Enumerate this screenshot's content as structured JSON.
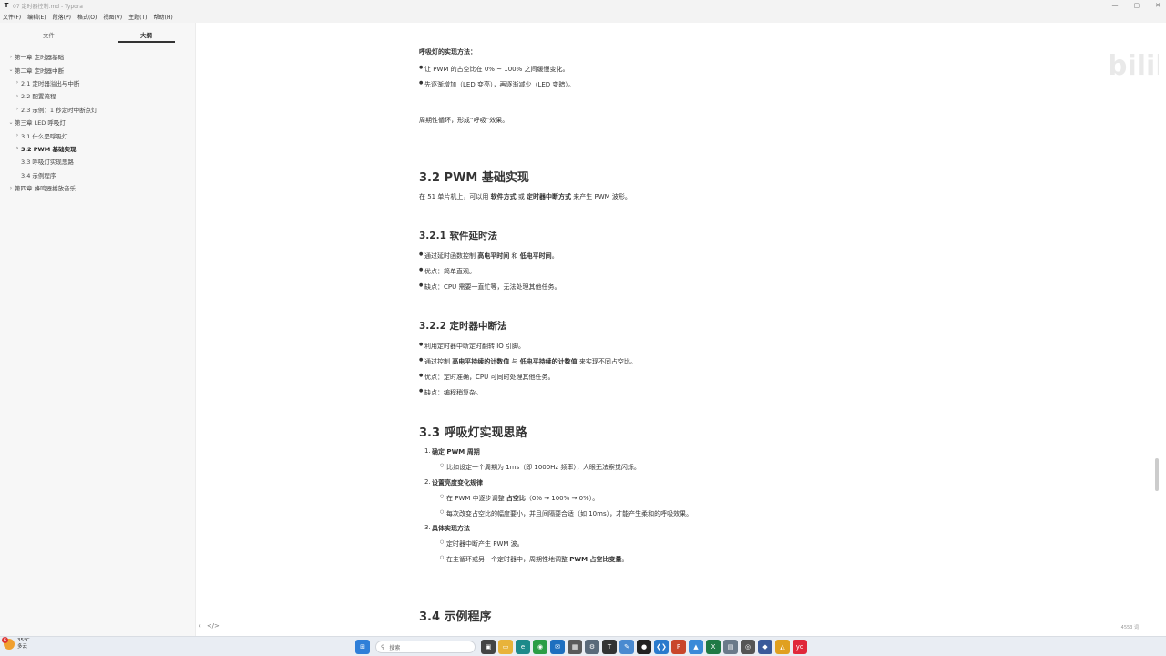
{
  "window": {
    "title": "07 定时器控制.md - Typora",
    "app_icon": "T",
    "minimize": "—",
    "maximize": "▢",
    "close": "✕"
  },
  "menu": [
    "文件(F)",
    "编辑(E)",
    "段落(P)",
    "格式(O)",
    "视图(V)",
    "主题(T)",
    "帮助(H)"
  ],
  "sidebar": {
    "tabs": [
      "文件",
      "大纲"
    ],
    "active_tab": 1,
    "outline": [
      {
        "label": "第一章 定时器基础",
        "level": 1,
        "chevron": "›",
        "active": false
      },
      {
        "label": "第二章 定时器中断",
        "level": 1,
        "chevron": "⌄",
        "active": false
      },
      {
        "label": "2.1 定时器溢出与中断",
        "level": 2,
        "chevron": "›",
        "active": false
      },
      {
        "label": "2.2 配置流程",
        "level": 2,
        "chevron": "›",
        "active": false
      },
      {
        "label": "2.3 示例：1 秒定时中断点灯",
        "level": 2,
        "chevron": "›",
        "active": false
      },
      {
        "label": "第三章 LED 呼吸灯",
        "level": 1,
        "chevron": "⌄",
        "active": false
      },
      {
        "label": "3.1 什么是呼吸灯",
        "level": 2,
        "chevron": "›",
        "active": false
      },
      {
        "label": "3.2 PWM 基础实现",
        "level": 2,
        "chevron": "›",
        "active": true
      },
      {
        "label": "3.3 呼吸灯实现思路",
        "level": 2,
        "chevron": "",
        "active": false
      },
      {
        "label": "3.4 示例程序",
        "level": 2,
        "chevron": "",
        "active": false
      },
      {
        "label": "第四章 蜂鸣器播放音乐",
        "level": 1,
        "chevron": "›",
        "active": false
      }
    ]
  },
  "status": {
    "left_icons": [
      "‹",
      "</>"
    ],
    "word_count": "4553 词"
  },
  "doc": {
    "breath_method_title": "呼吸灯的实现方法：",
    "breath_items": [
      "让 PWM 的占空比在 0% ~ 100% 之间缓慢变化。",
      "先逐渐增加（LED 变亮），再逐渐减少（LED 变暗）。"
    ],
    "cycle_text": "周期性循环，形成“呼吸”效果。",
    "h_32": "3.2 PWM 基础实现",
    "intro_32": {
      "a": "在 51 单片机上，可以用 ",
      "b": "软件方式",
      "c": " 或 ",
      "d": "定时器中断方式",
      "e": " 来产生 PWM 波形。"
    },
    "h_321": "3.2.1 软件延时法",
    "sw_item1": {
      "a": "通过延时函数控制 ",
      "b": "高电平时间",
      "c": " 和 ",
      "d": "低电平时间",
      "e": "。"
    },
    "sw_item2": "优点：简单直观。",
    "sw_item3": "缺点：CPU 需要一直忙等，无法处理其他任务。",
    "h_322": "3.2.2 定时器中断法",
    "ti_item1": "利用定时器中断定时翻转 IO 引脚。",
    "ti_item2": {
      "a": "通过控制 ",
      "b": "高电平持续的计数值",
      "c": " 与 ",
      "d": "低电平持续的计数值",
      "e": " 来实现不同占空比。"
    },
    "ti_item3": "优点：定时准确，CPU 可同时处理其他任务。",
    "ti_item4": "缺点：编程稍复杂。",
    "h_33": "3.3 呼吸灯实现思路",
    "step1": {
      "num": "1.",
      "title": "确定 PWM 周期"
    },
    "step1_sub": "比如设定一个周期为 1ms（即 1000Hz 频率），人眼无法察觉闪烁。",
    "step2": {
      "num": "2.",
      "title": "设置亮度变化规律"
    },
    "step2_sub1": {
      "a": "在 PWM 中逐步调整 ",
      "b": "占空比",
      "c": "（0% → 100% → 0%）。"
    },
    "step2_sub2": "每次改变占空比的幅度要小，并且间隔要合适（如 10ms），才能产生柔和的呼吸效果。",
    "step3": {
      "num": "3.",
      "title": "具体实现方法"
    },
    "step3_sub1": "定时器中断产生 PWM 波。",
    "step3_sub2": {
      "a": "在主循环或另一个定时器中，周期性地调整 ",
      "b": "PWM 占空比变量",
      "c": "。"
    },
    "h_34": "3.4 示例程序"
  },
  "watermark": {
    "text": "bilibili"
  },
  "taskbar": {
    "weather_temp": "35°C",
    "weather_desc": "多云",
    "weather_badge": "6",
    "search_placeholder": "搜索",
    "apps": [
      {
        "name": "windows-start-icon",
        "glyph": "⊞",
        "color": "#2f7fd8"
      },
      {
        "name": "task-view-icon",
        "glyph": "▣",
        "color": "#444"
      },
      {
        "name": "file-explorer-icon",
        "glyph": "▭",
        "color": "#e8b33a"
      },
      {
        "name": "edge-icon",
        "glyph": "e",
        "color": "#1d8a8a"
      },
      {
        "name": "chrome-icon",
        "glyph": "◉",
        "color": "#2a9d45"
      },
      {
        "name": "mail-icon",
        "glyph": "✉",
        "color": "#1e6fbf"
      },
      {
        "name": "calculator-icon",
        "glyph": "▦",
        "color": "#5a5a5a"
      },
      {
        "name": "settings-icon",
        "glyph": "⚙",
        "color": "#5a6a7a"
      },
      {
        "name": "typora-icon",
        "glyph": "T",
        "color": "#333"
      },
      {
        "name": "notepad-icon",
        "glyph": "✎",
        "color": "#4a8ad0"
      },
      {
        "name": "obs-icon",
        "glyph": "●",
        "color": "#222"
      },
      {
        "name": "vscode-icon",
        "glyph": "❮❯",
        "color": "#2a7acc"
      },
      {
        "name": "powerpoint-icon",
        "glyph": "P",
        "color": "#c9462b"
      },
      {
        "name": "photos-icon",
        "glyph": "▲",
        "color": "#3a8ad8"
      },
      {
        "name": "excel-icon",
        "glyph": "X",
        "color": "#1f7a45"
      },
      {
        "name": "app-icon",
        "glyph": "▤",
        "color": "#6a7a8a"
      },
      {
        "name": "camera-icon",
        "glyph": "◎",
        "color": "#555"
      },
      {
        "name": "keil-icon",
        "glyph": "◆",
        "color": "#3a5a9a"
      },
      {
        "name": "app2-icon",
        "glyph": "◭",
        "color": "#e0a020"
      },
      {
        "name": "youdao-icon",
        "glyph": "yd",
        "color": "#e0283a"
      }
    ]
  }
}
